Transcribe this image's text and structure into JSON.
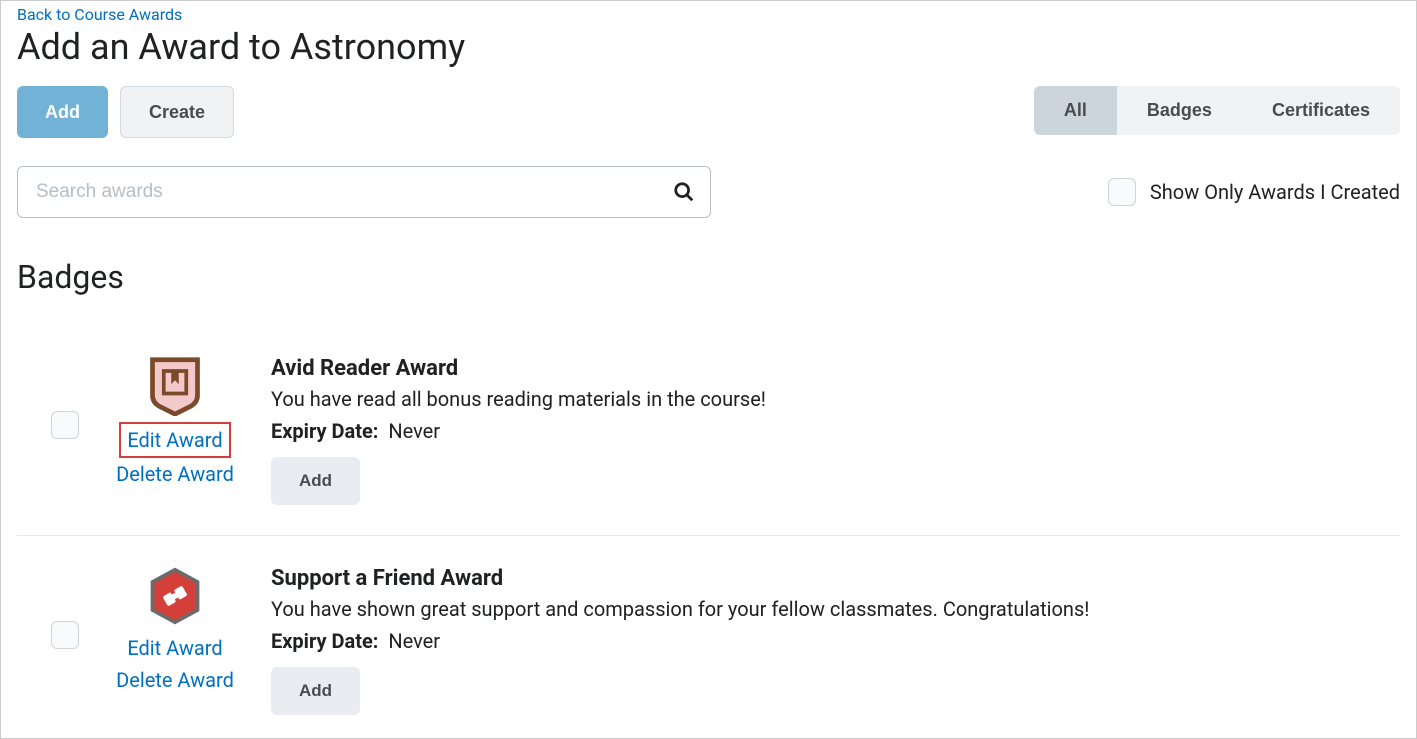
{
  "nav": {
    "back_link": "Back to Course Awards"
  },
  "page_title": "Add an Award to Astronomy",
  "toolbar": {
    "add_label": "Add",
    "create_label": "Create"
  },
  "filters": {
    "all": "All",
    "badges": "Badges",
    "certificates": "Certificates"
  },
  "search": {
    "placeholder": "Search awards"
  },
  "show_only_label": "Show Only Awards I Created",
  "section_title": "Badges",
  "expiry_label_text": "Expiry Date:",
  "edit_link_text": "Edit Award",
  "delete_link_text": "Delete Award",
  "add_small_label": "Add",
  "awards": [
    {
      "title": "Avid Reader Award",
      "description": "You have read all bonus reading materials in the course!",
      "expiry": "Never",
      "icon": "reader-badge"
    },
    {
      "title": "Support a Friend Award",
      "description": "You have shown great support and compassion for your fellow classmates. Congratulations!",
      "expiry": "Never",
      "icon": "support-badge"
    }
  ]
}
